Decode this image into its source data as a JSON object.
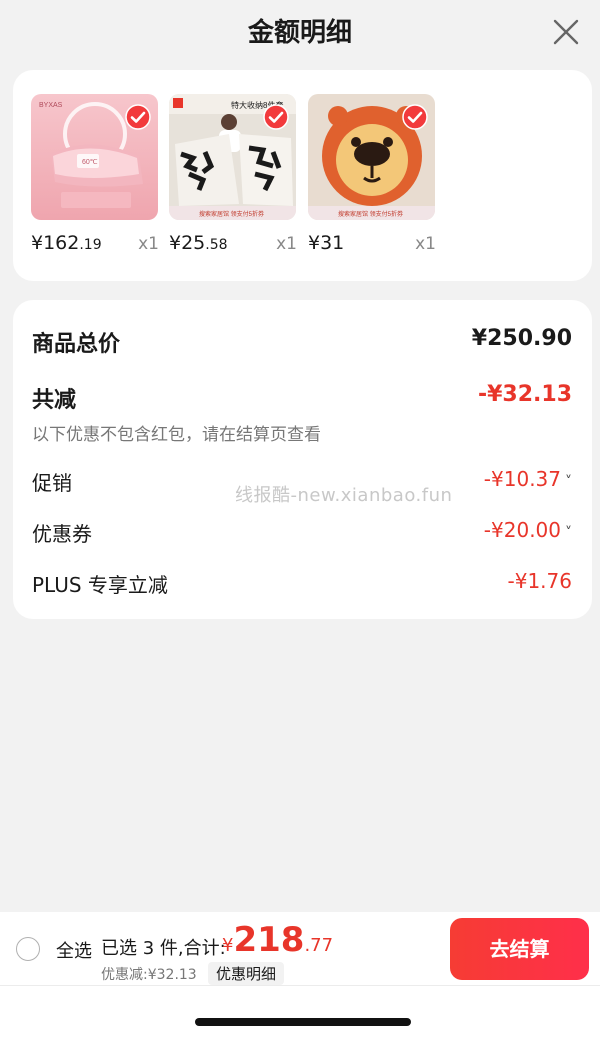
{
  "header": {
    "title": "金额明细"
  },
  "products": [
    {
      "price_int": "¥162",
      "price_dec": ".19",
      "qty": "x1",
      "thumb_text": [
        "BYXAS",
        "60℃"
      ]
    },
    {
      "price_int": "¥25",
      "price_dec": ".58",
      "qty": "x1",
      "thumb_text": [
        "特大收纳8件套",
        "搜索家居馆 领支付5折券"
      ]
    },
    {
      "price_int": "¥31",
      "price_dec": "",
      "qty": "x1",
      "thumb_text": [
        "搜索家居馆 领支付5折券"
      ]
    }
  ],
  "summary": {
    "total_label": "商品总价",
    "total_value": "¥250.90",
    "reduce_label": "共减",
    "reduce_value": "-¥32.13",
    "note": "以下优惠不包含红包，请在结算页查看",
    "rows": [
      {
        "label": "促销",
        "value": "-¥10.37",
        "chevron": "˅"
      },
      {
        "label": "优惠券",
        "value": "-¥20.00",
        "chevron": "˅"
      },
      {
        "label": "PLUS 专享立减",
        "value": "-¥1.76",
        "chevron": ""
      }
    ]
  },
  "watermark": "线报酷-new.xianbao.fun",
  "bottom": {
    "select_all": "全选",
    "selected_text": "已选 3 件,合计:",
    "total_symbol": "¥",
    "total_int": "218",
    "total_dec": ".77",
    "discount_text": "优惠减:¥32.13",
    "detail_button": "优惠明细",
    "checkout_button": "去结算"
  },
  "colors": {
    "accent_red": "#e8352a",
    "checkout_gradient_start": "#f63c34",
    "checkout_gradient_end": "#ff2f4a",
    "background": "#f2f2f2"
  }
}
